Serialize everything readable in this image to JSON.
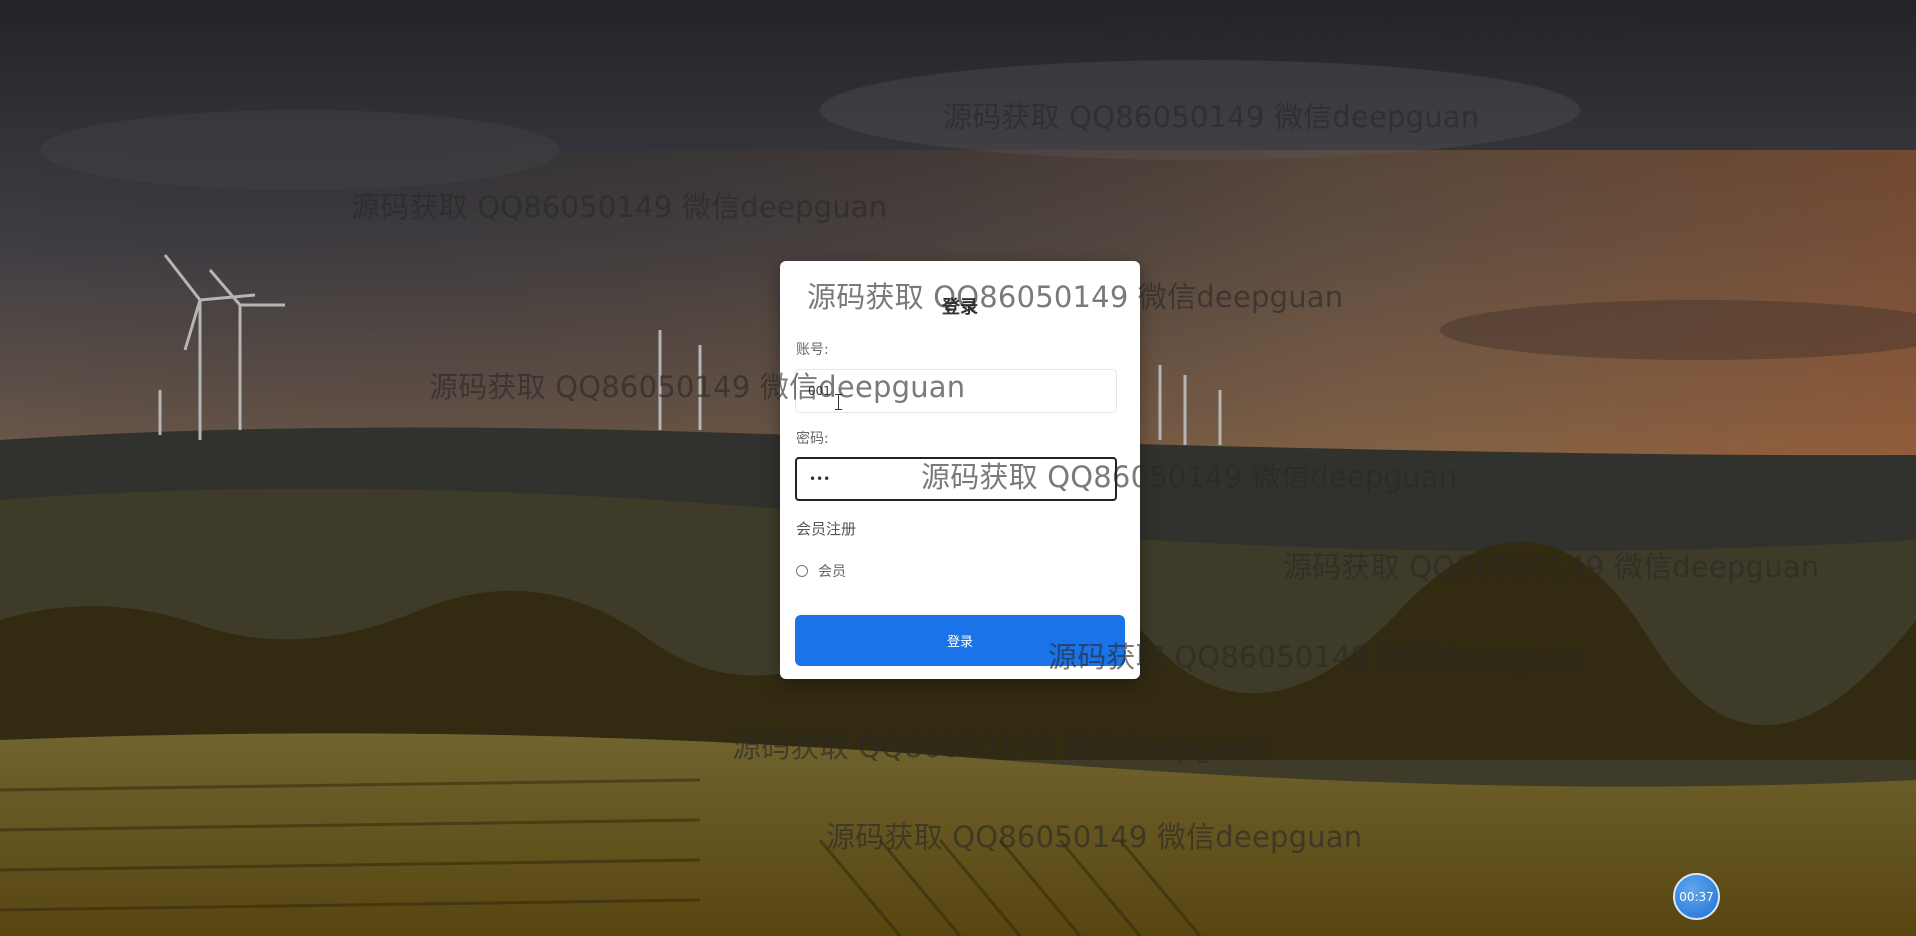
{
  "dialog": {
    "title": "登录",
    "account_label": "账号:",
    "account_value": "001",
    "password_label": "密码:",
    "password_value": "•••",
    "register_label": "会员注册",
    "role_option": "会员",
    "login_button": "登录"
  },
  "timer": "00:37",
  "watermark_text": "源码获取 QQ86050149 微信deepguan",
  "colors": {
    "primary_button": "#1a73e8",
    "dialog_bg": "#ffffff",
    "watermark": "#3a3a3a"
  }
}
